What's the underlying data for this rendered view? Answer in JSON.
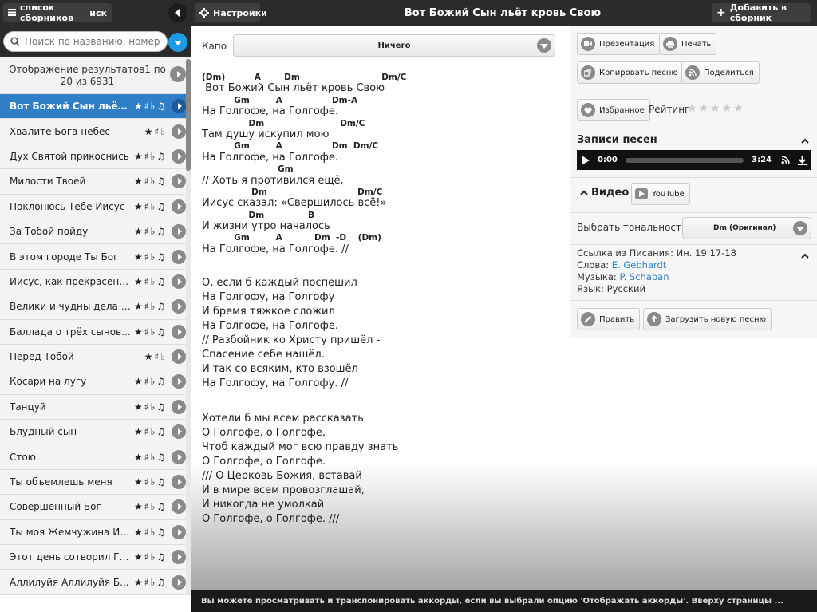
{
  "sidebar": {
    "collection_label": "список сборников",
    "collection_suffix": "иск",
    "search_placeholder": "Поиск по названию, номеру ил...",
    "results_text": "Отображение результатов1 по 20 из 6931",
    "items": [
      {
        "title": "Вот Божий Сын льёт к...",
        "flags": "★♯♭♫",
        "active": true
      },
      {
        "title": "Хвалите Бога небес",
        "flags": "★♯♭"
      },
      {
        "title": "Дух Святой прикоснись",
        "flags": "★♯♭♫"
      },
      {
        "title": "Милости Твоей",
        "flags": "★♯♭♫"
      },
      {
        "title": "Поклонюсь Тебе Иисус",
        "flags": "★♯♭♫"
      },
      {
        "title": "За Тобой пойду",
        "flags": "★♯♭♫"
      },
      {
        "title": "В этом городе Ты Бог",
        "flags": "★♯♭♫"
      },
      {
        "title": "Иисус, как прекрасен Т...",
        "flags": "★♯♭♫"
      },
      {
        "title": "Велики и чудны дела Т...",
        "flags": "★♯♭♫"
      },
      {
        "title": "Баллада о трёх сынов...",
        "flags": "★♯♭♫"
      },
      {
        "title": "Перед Тобой",
        "flags": "★♯♭"
      },
      {
        "title": "Косари на лугу",
        "flags": "★♯♭♫"
      },
      {
        "title": "Танцуй",
        "flags": "★♯♭♫"
      },
      {
        "title": "Блудный сын",
        "flags": "★♯♭♫"
      },
      {
        "title": "Стою",
        "flags": "★♯♭♫"
      },
      {
        "title": "Ты объемлешь меня",
        "flags": "★♯♭♫"
      },
      {
        "title": "Совершенный Бог",
        "flags": "★♯♭♫"
      },
      {
        "title": "Ты моя Жемчужина Ии...",
        "flags": "★♯♭♫"
      },
      {
        "title": "Этот день сотворил Госп...",
        "flags": "★♯♭♫"
      },
      {
        "title": "Аллилуйя Аллилуйя Б...",
        "flags": "★♯♭♫"
      }
    ]
  },
  "topbar": {
    "settings_label": "Настройки",
    "title": "Вот Божий Сын льёт кровь Свою",
    "add_label": "Добавить в сборник"
  },
  "main": {
    "capo_label": "Капо",
    "capo_value": "Ничего",
    "verse1": [
      {
        "chord": "(Dm)          A        Dm                            Dm/C",
        "lyric": " Вот Божий Сын льёт кровь Свою"
      },
      {
        "chord": "           Gm         A                 Dm-A",
        "lyric": "На Голгофе, на Голгофе."
      },
      {
        "chord": "                Dm                          Dm/C",
        "lyric": "Там душу искупил мою"
      },
      {
        "chord": "           Gm         A                 Dm  Dm/C",
        "lyric": "На Голгофе, на Голгофе."
      },
      {
        "chord": "                          Gm",
        "lyric": "// Хоть я противился ещё,"
      },
      {
        "chord": "                 Dm                               Dm/C",
        "lyric": "Иисус сказал: «Свершилось всё!»"
      },
      {
        "chord": "                Dm               B",
        "lyric": "И жизни утро началось"
      },
      {
        "chord": "           Gm         A           Dm  -D    (Dm)",
        "lyric": "На Голгофе, на Голгофе. //"
      }
    ],
    "verse2": [
      "О, если б каждый поспешил",
      "На Голгофу, на Голгофу",
      "И бремя тяжкое сложил",
      "На Голгофе, на Голгофе.",
      "// Разбойник ко Христу пришёл -",
      "Спасение себе нашёл.",
      "И так со всяким, кто взошёл",
      "На Голгофу, на Голгофу. //"
    ],
    "verse3": [
      "Хотели б мы всем рассказать",
      "О Голгофе, о Голгофе,",
      "Чтоб каждый мог всю правду знать",
      "О Голгофе, о Голгофе.",
      "/// О Церковь Божия, вставай",
      "И в мире всем провозглашай,",
      "И никогда не умолкай",
      "О Голгофе, о Голгофе. ///"
    ]
  },
  "panel": {
    "presentation": "Презентация",
    "print": "Печать",
    "copy": "Копировать песню",
    "share": "Поделиться",
    "favorite": "Избранное",
    "rating_label": "Рейтинг",
    "rating_stars": "★★★★★",
    "recordings_header": "Записи песен",
    "player_current": "0:00",
    "player_duration": "3:24",
    "video_header": "Видео",
    "youtube": "YouTube",
    "tone_label": "Выбрать тональность",
    "tone_value": "Dm (Оригинал)",
    "scripture_label": "Ссылка из Писания: Ин. 19:17-18",
    "words_label": "Слова: ",
    "words_author": "E. Gebhardt",
    "music_label": "Музыка: ",
    "music_author": "P. Schaban",
    "language_label": "Язык: Русский",
    "edit": "Править",
    "upload": "Загрузить новую песню"
  },
  "bottom": {
    "hint": "Вы можете просматривать и транспонировать аккорды, если вы выбрали опцию 'Отображать аккорды'. Вверху страницы ..."
  }
}
